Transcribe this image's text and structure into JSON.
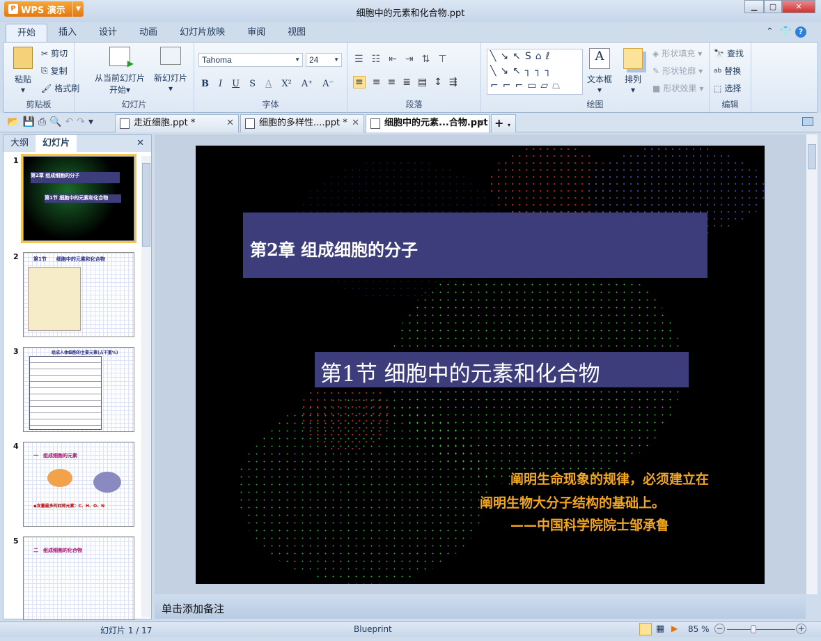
{
  "app": {
    "brand": "WPS 演示",
    "window_title": "细胞中的元素和化合物.ppt"
  },
  "menu": {
    "tabs": [
      "开始",
      "插入",
      "设计",
      "动画",
      "幻灯片放映",
      "审阅",
      "视图"
    ]
  },
  "ribbon": {
    "clipboard": {
      "paste": "粘贴",
      "cut": "剪切",
      "copy": "复制",
      "format_painter": "格式刷",
      "label": "剪贴板"
    },
    "slides": {
      "from_current": "从当前幻灯片",
      "from_current2": "开始",
      "new_slide": "新幻灯片",
      "label": "幻灯片"
    },
    "font": {
      "name": "Tahoma",
      "size": "24",
      "label": "字体",
      "bold": "B",
      "italic": "I",
      "underline": "U",
      "shadow": "S",
      "fontcolor": "A",
      "superscript": "X²",
      "grow": "A⁺",
      "shrink": "A⁻"
    },
    "paragraph": {
      "label": "段落"
    },
    "drawing": {
      "textbox": "文本框",
      "arrange": "排列",
      "fill": "形状填充",
      "outline": "形状轮廓",
      "effect": "形状效果",
      "label": "绘图"
    },
    "editing": {
      "find": "查找",
      "replace": "替换",
      "select": "选择",
      "label": "编辑"
    }
  },
  "doc_tabs": [
    {
      "label": "走近细胞.ppt *"
    },
    {
      "label": "细胞的多样性....ppt *"
    },
    {
      "label": "细胞中的元素...合物.ppt"
    }
  ],
  "left_panel": {
    "tabs": [
      "大纲",
      "幻灯片"
    ],
    "thumbs": [
      {
        "num": "1",
        "title": "第1节 细胞中的元素和化合物",
        "sub": "第2章 组成细胞的分子"
      },
      {
        "num": "2",
        "title": "第1节　　细胞中的元素和化合物"
      },
      {
        "num": "3",
        "title": "组成人体细胞的主要元素(占干重%)"
      },
      {
        "num": "4",
        "title": "一　组成细胞的元素",
        "sub": "◆含量最多的四种元素：C、H、O、N"
      },
      {
        "num": "5",
        "title": "二　组成细胞的化合物"
      }
    ]
  },
  "slide": {
    "title": "第2章  组成细胞的分子",
    "subtitle": "第1节  细胞中的元素和化合物",
    "quote": [
      "阐明生命现象的规律，必须建立在",
      "阐明生物大分子结构的基础上。",
      "——中国科学院院士邹承鲁"
    ]
  },
  "notes": {
    "placeholder": "单击添加备注"
  },
  "status": {
    "slide_pos": "幻灯片 1 / 17",
    "theme": "Blueprint",
    "zoom": "85 %",
    "zoom_fraction": 0.35
  },
  "colors": {
    "title_box": "#3e3d7c",
    "quote": "#f2a51e",
    "accent": "#e4780f"
  }
}
